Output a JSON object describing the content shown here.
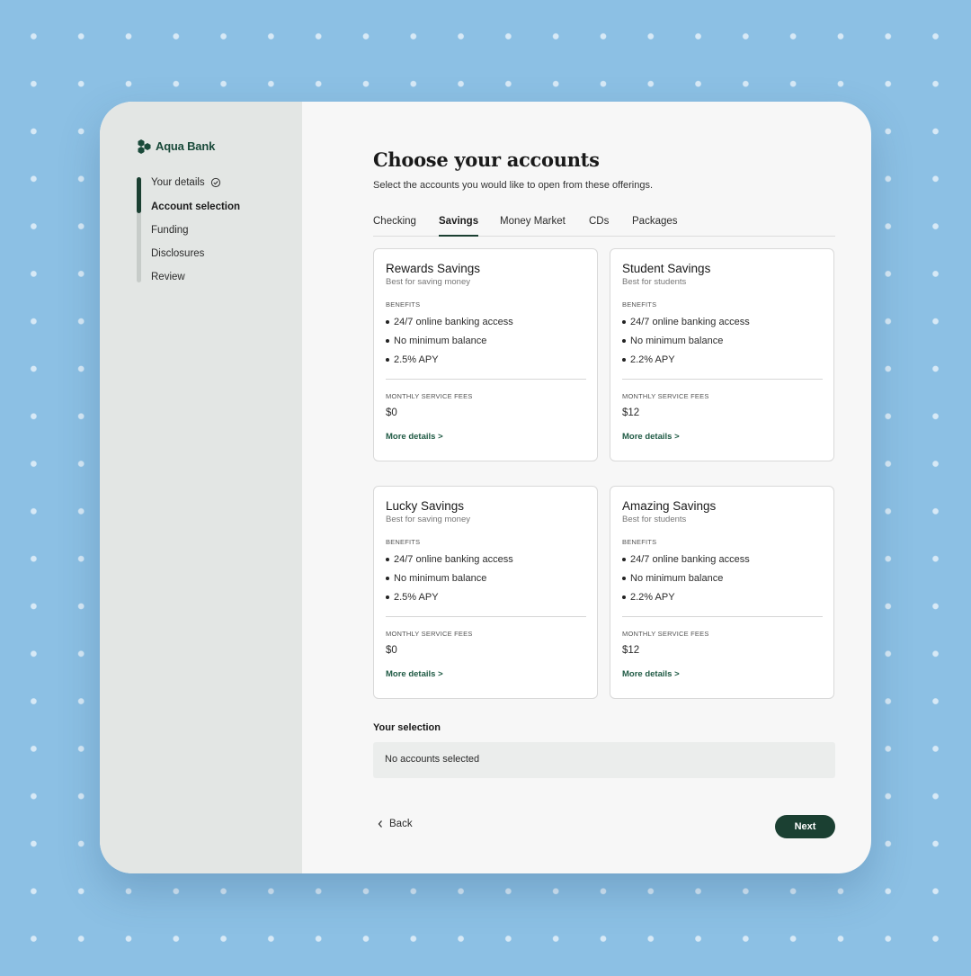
{
  "brand": {
    "name": "Aqua Bank",
    "icon": "hexagon-cluster-logo",
    "color": "#1a4a3a"
  },
  "sidebar": {
    "steps": [
      {
        "label": "Your details",
        "status": "complete",
        "icon": "check-circle-icon"
      },
      {
        "label": "Account selection",
        "status": "current"
      },
      {
        "label": "Funding",
        "status": "upcoming"
      },
      {
        "label": "Disclosures",
        "status": "upcoming"
      },
      {
        "label": "Review",
        "status": "upcoming"
      }
    ]
  },
  "header": {
    "title": "Choose your accounts",
    "subtitle": "Select the accounts you would like to open from these offerings."
  },
  "tabs": [
    {
      "label": "Checking",
      "active": false
    },
    {
      "label": "Savings",
      "active": true
    },
    {
      "label": "Money Market",
      "active": false
    },
    {
      "label": "CDs",
      "active": false
    },
    {
      "label": "Packages",
      "active": false
    }
  ],
  "cards": [
    {
      "title": "Rewards Savings",
      "subtitle": "Best for saving money",
      "benefits_label": "BENEFITS",
      "benefits": [
        "24/7 online banking access",
        "No minimum balance",
        "2.5% APY"
      ],
      "fees_label": "MONTHLY SERVICE FEES",
      "fees": "$0",
      "link": "More details >"
    },
    {
      "title": "Student Savings",
      "subtitle": "Best for students",
      "benefits_label": "BENEFITS",
      "benefits": [
        "24/7 online banking access",
        "No minimum balance",
        "2.2% APY"
      ],
      "fees_label": "MONTHLY SERVICE FEES",
      "fees": "$12",
      "link": "More details >"
    },
    {
      "title": "Lucky Savings",
      "subtitle": "Best for saving money",
      "benefits_label": "BENEFITS",
      "benefits": [
        "24/7 online banking access",
        "No minimum balance",
        "2.5% APY"
      ],
      "fees_label": "MONTHLY SERVICE FEES",
      "fees": "$0",
      "link": "More details >"
    },
    {
      "title": "Amazing Savings",
      "subtitle": "Best for students",
      "benefits_label": "BENEFITS",
      "benefits": [
        "24/7 online banking access",
        "No minimum balance",
        "2.2% APY"
      ],
      "fees_label": "MONTHLY SERVICE FEES",
      "fees": "$12",
      "link": "More details >"
    }
  ],
  "selection": {
    "label": "Your selection",
    "empty_text": "No accounts selected"
  },
  "footer": {
    "back_label": "Back",
    "back_icon": "chevron-left-icon",
    "next_label": "Next"
  },
  "colors": {
    "accent": "#1b4032",
    "background": "#8cc0e4",
    "sidebar": "#e3e6e4",
    "link": "#1f5a44"
  }
}
